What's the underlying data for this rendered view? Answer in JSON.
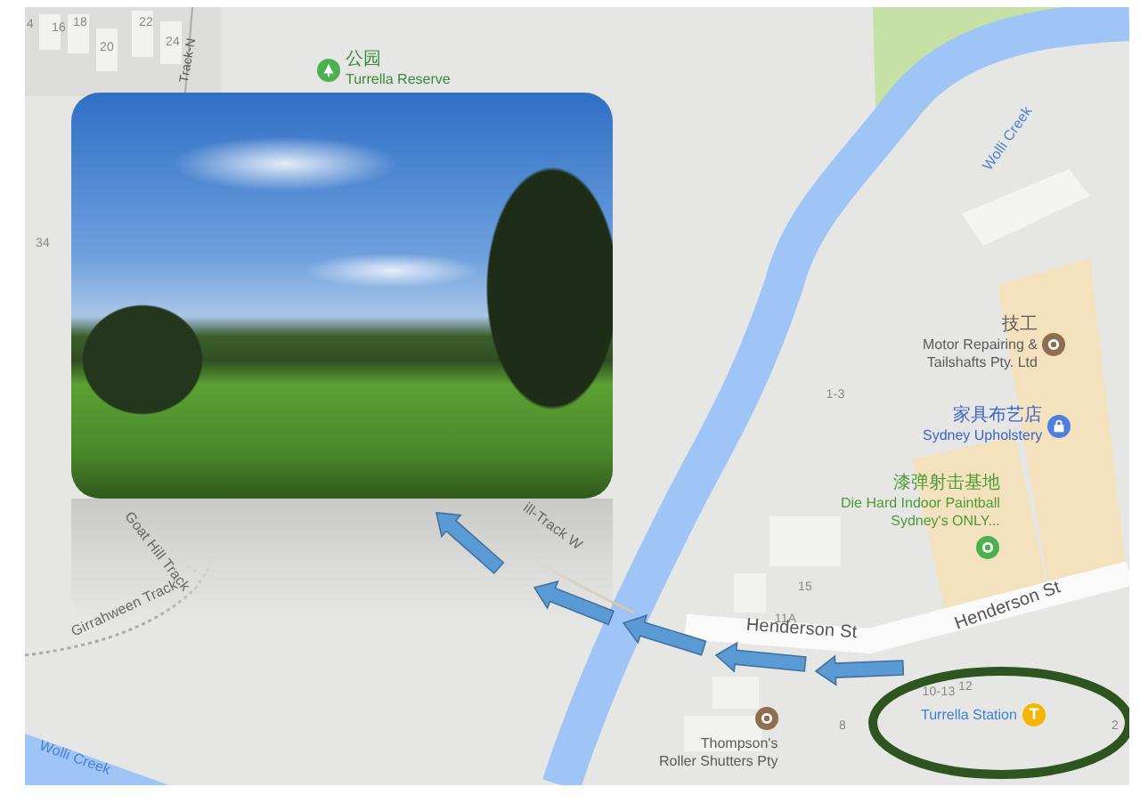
{
  "map": {
    "places": [
      {
        "kind": "park",
        "color": "#4caf50",
        "native_name": "公园",
        "name_lines": [
          "Turrella Reserve"
        ]
      },
      {
        "kind": "service",
        "color": "#8d6e4f",
        "native_name": "技工",
        "name_lines": [
          "Motor Repairing &",
          "Tailshafts Pty. Ltd"
        ]
      },
      {
        "kind": "shop",
        "color": "#4f7de0",
        "native_name": "家具布艺店",
        "name_lines": [
          "Sydney Upholstery"
        ]
      },
      {
        "kind": "leisure",
        "color": "#4caf50",
        "native_name": "漆弹射击基地",
        "name_lines": [
          "Die Hard Indoor Paintball",
          "Sydney's ONLY..."
        ]
      },
      {
        "kind": "service",
        "color": "#8d6e4f",
        "name_lines": [
          "Thompson's",
          "Roller Shutters Pty"
        ]
      },
      {
        "kind": "station",
        "color": "#f4b400",
        "icon_text": "T",
        "name_lines": [
          "Turrella Station"
        ]
      }
    ],
    "waterways": [
      "Wolli Creek",
      "Wolli Creek"
    ],
    "streets": [
      "Henderson St",
      "Henderson St",
      "Track-N"
    ],
    "tracks": [
      "Goat Hill Track",
      "Girrahween Track",
      "ill-Track W"
    ],
    "lot_numbers": [
      "4",
      "16",
      "18",
      "20",
      "22",
      "24",
      "34",
      "1-3",
      "15",
      "11A",
      "10-13",
      "12",
      "8",
      "2"
    ]
  }
}
